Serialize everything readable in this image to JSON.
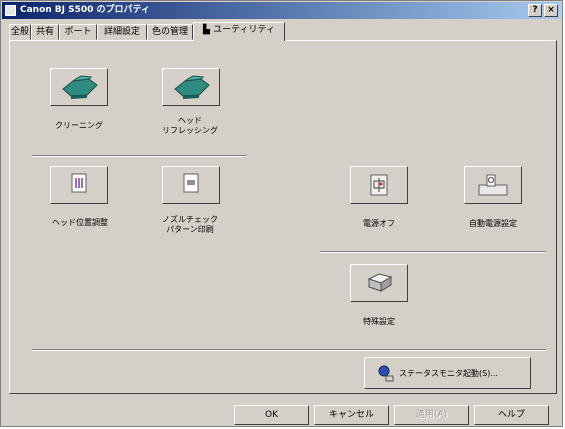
{
  "window": {
    "title": "Canon BJ S500 のプロパティ",
    "help_button": "?",
    "close_button": "×"
  },
  "tabs": [
    {
      "label": "全般"
    },
    {
      "label": "共有"
    },
    {
      "label": "ポート"
    },
    {
      "label": "詳細設定"
    },
    {
      "label": "色の管理"
    },
    {
      "label": "ユーティリティ"
    }
  ],
  "utility": {
    "cleaning_label": "クリーニング",
    "deep_cleaning_label": "ヘッド\nリフレッシング",
    "head_alignment_label": "ヘッド位置調整",
    "nozzle_check_label": "ノズルチェック\nパターン印刷",
    "power_off_label": "電源オフ",
    "auto_power_label": "自動電源設定",
    "special_settings_label": "特殊設定",
    "status_monitor_label": "ステータスモニタ起動(S)..."
  },
  "footer": {
    "ok_label": "OK",
    "cancel_label": "キャンセル",
    "apply_label": "適用(A)",
    "help_label": "ヘルプ"
  },
  "colors": {
    "title_start": "#0a246a",
    "title_end": "#a6caf0",
    "face": "#d4d0c8",
    "printer_teal": "#2f8a80"
  }
}
